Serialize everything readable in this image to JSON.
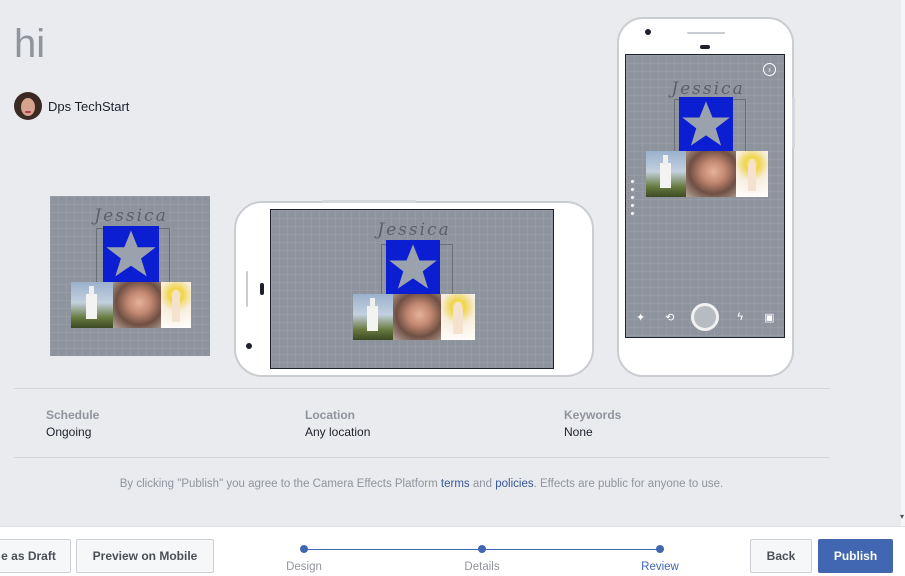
{
  "effect": {
    "title": "hi",
    "author": "Dps TechStart",
    "handwriting": "Jessica"
  },
  "details": {
    "schedule_label": "Schedule",
    "schedule_value": "Ongoing",
    "location_label": "Location",
    "location_value": "Any location",
    "keywords_label": "Keywords",
    "keywords_value": "None"
  },
  "terms": {
    "prefix": "By clicking \"Publish\" you agree to the Camera Effects Platform ",
    "terms_link": "terms",
    "middle": " and ",
    "policies_link": "policies",
    "suffix": ". Effects are public for anyone to use."
  },
  "footer": {
    "save_draft": "e as Draft",
    "preview_mobile": "Preview on Mobile",
    "back": "Back",
    "publish": "Publish",
    "steps": [
      {
        "label": "Design"
      },
      {
        "label": "Details"
      },
      {
        "label": "Review",
        "active": true
      }
    ]
  },
  "icons": {
    "wand": "magic-wand-icon",
    "flip": "camera-flip-icon",
    "flash": "flash-icon",
    "gallery": "gallery-icon",
    "settings": "settings-icon"
  },
  "colors": {
    "primary": "#4267b2",
    "star_background": "#0b1ed1",
    "preview_background": "#8e949e"
  }
}
